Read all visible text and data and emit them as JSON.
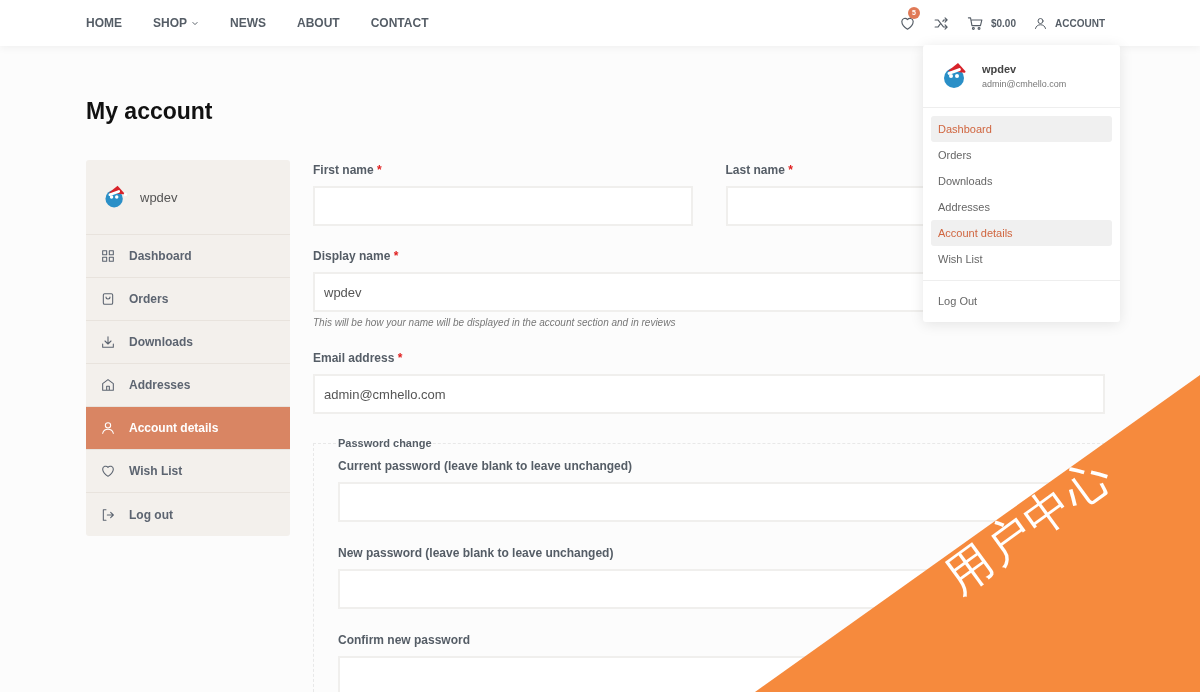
{
  "header": {
    "nav": [
      {
        "label": "HOME",
        "dropdown": false
      },
      {
        "label": "SHOP",
        "dropdown": true
      },
      {
        "label": "NEWS",
        "dropdown": false
      },
      {
        "label": "ABOUT",
        "dropdown": false
      },
      {
        "label": "CONTACT",
        "dropdown": false
      }
    ],
    "wishlist_count": "5",
    "cart_total": "$0.00",
    "account_label": "ACCOUNT"
  },
  "account_menu": {
    "name": "wpdev",
    "email": "admin@cmhello.com",
    "items": [
      {
        "label": "Dashboard",
        "selected": true
      },
      {
        "label": "Orders",
        "selected": false
      },
      {
        "label": "Downloads",
        "selected": false
      },
      {
        "label": "Addresses",
        "selected": false
      },
      {
        "label": "Account details",
        "selected": true
      },
      {
        "label": "Wish List",
        "selected": false
      }
    ],
    "logout": "Log Out"
  },
  "page_title": "My account",
  "sidebar": {
    "user": "wpdev",
    "items": [
      {
        "label": "Dashboard",
        "selected": false
      },
      {
        "label": "Orders",
        "selected": false
      },
      {
        "label": "Downloads",
        "selected": false
      },
      {
        "label": "Addresses",
        "selected": false
      },
      {
        "label": "Account details",
        "selected": true
      },
      {
        "label": "Wish List",
        "selected": false
      },
      {
        "label": "Log out",
        "selected": false
      }
    ]
  },
  "form": {
    "name_fields": [
      {
        "label": "First name",
        "required_mark": "*"
      },
      {
        "label": "Last name",
        "required_mark": "*"
      }
    ],
    "display_name": {
      "label": "Display name",
      "required_mark": "*",
      "value": "wpdev",
      "hint": "This will be how your name will be displayed in the account section and in reviews"
    },
    "email": {
      "label": "Email address",
      "required_mark": "*",
      "value": "admin@cmhello.com"
    },
    "password_change": {
      "legend": "Password change",
      "fields": [
        {
          "label": "Current password (leave blank to leave unchanged)"
        },
        {
          "label": "New password (leave blank to leave unchanged)"
        },
        {
          "label": "Confirm new password"
        }
      ]
    }
  },
  "ribbon": {
    "text": "用户中心"
  }
}
